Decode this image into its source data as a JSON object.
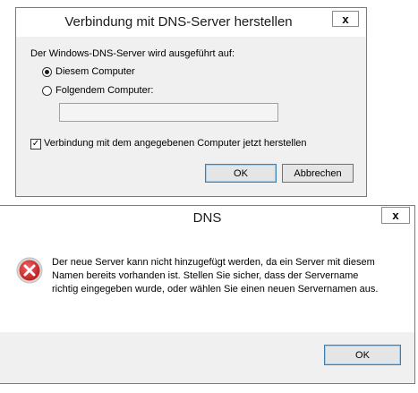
{
  "dns_connect_dialog": {
    "title": "Verbindung mit DNS-Server herstellen",
    "close_glyph": "x",
    "server_running_on_label": "Der Windows-DNS-Server wird ausgeführt auf:",
    "option_this_computer": "Diesem Computer",
    "option_following_computer": "Folgendem Computer:",
    "computer_name_value": "",
    "selected_option": "this_computer",
    "connect_now_label": "Verbindung mit dem angegebenen Computer jetzt herstellen",
    "connect_now_checked": true,
    "ok_label": "OK",
    "cancel_label": "Abbrechen"
  },
  "error_dialog": {
    "title": "DNS",
    "close_glyph": "x",
    "message": "Der neue Server kann nicht hinzugefügt werden, da ein Server mit diesem Namen bereits vorhanden ist. Stellen Sie sicher, dass der Servername richtig eingegeben wurde, oder wählen Sie einen neuen Servernamen aus.",
    "icon": "error-icon",
    "ok_label": "OK"
  }
}
